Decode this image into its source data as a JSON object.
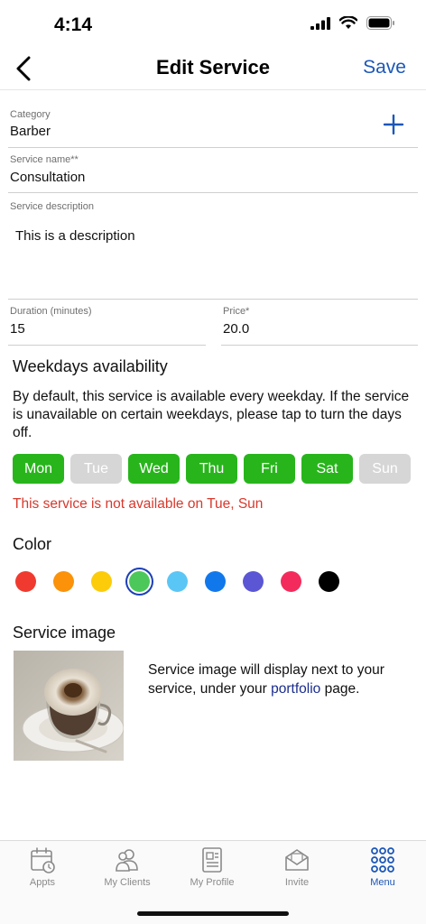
{
  "status_bar": {
    "time": "4:14"
  },
  "nav": {
    "title": "Edit Service",
    "save_label": "Save"
  },
  "form": {
    "category": {
      "label": "Category",
      "value": "Barber"
    },
    "service_name": {
      "label": "Service name**",
      "value": "Consultation"
    },
    "description": {
      "label": "Service description",
      "value": "This is a description"
    },
    "duration": {
      "label": "Duration (minutes)",
      "value": "15"
    },
    "price": {
      "label": "Price*",
      "value": "20.0"
    }
  },
  "weekdays": {
    "title": "Weekdays availability",
    "description": "By default, this service is available every weekday. If the service is unavailable on certain weekdays, please tap to turn the days off.",
    "days": [
      {
        "label": "Mon",
        "on": true
      },
      {
        "label": "Tue",
        "on": false
      },
      {
        "label": "Wed",
        "on": true
      },
      {
        "label": "Thu",
        "on": true
      },
      {
        "label": "Fri",
        "on": true
      },
      {
        "label": "Sat",
        "on": true
      },
      {
        "label": "Sun",
        "on": false
      }
    ],
    "unavailable_message": "This service is not available on Tue, Sun"
  },
  "color": {
    "title": "Color",
    "options": [
      {
        "name": "red",
        "hex": "#f03a2f"
      },
      {
        "name": "orange",
        "hex": "#fb9209"
      },
      {
        "name": "yellow",
        "hex": "#fccc0a"
      },
      {
        "name": "green",
        "hex": "#4cc85b",
        "selected": true
      },
      {
        "name": "light-blue",
        "hex": "#5ac6f5"
      },
      {
        "name": "blue",
        "hex": "#1178ec"
      },
      {
        "name": "purple",
        "hex": "#5b56d4"
      },
      {
        "name": "pink",
        "hex": "#f32b5c"
      },
      {
        "name": "black",
        "hex": "#000000"
      }
    ]
  },
  "service_image": {
    "title": "Service image",
    "note_prefix": "Service image will display next to your service, under your ",
    "note_link": "portfolio",
    "note_suffix": " page."
  },
  "tabs": [
    {
      "label": "Appts",
      "icon": "calendar-icon",
      "active": false
    },
    {
      "label": "My Clients",
      "icon": "clients-icon",
      "active": false
    },
    {
      "label": "My Profile",
      "icon": "profile-icon",
      "active": false
    },
    {
      "label": "Invite",
      "icon": "envelope-icon",
      "active": false
    },
    {
      "label": "Menu",
      "icon": "menu-grid-icon",
      "active": true
    }
  ]
}
